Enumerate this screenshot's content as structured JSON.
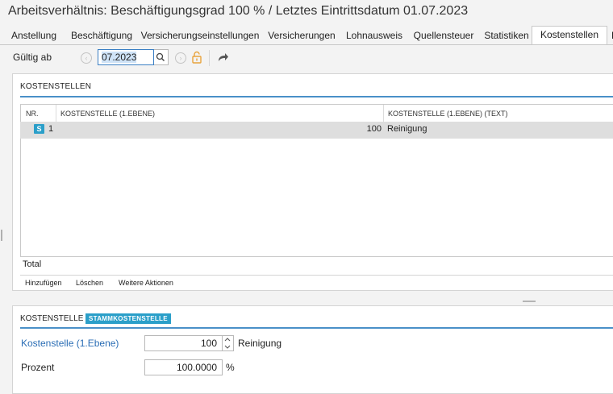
{
  "window": {
    "title": "Arbeitsverhältnis: Beschäftigungsgrad 100 % / Letztes Eintrittsdatum 01.07.2023"
  },
  "tabs": [
    {
      "label": "Anstellung"
    },
    {
      "label": "Beschäftigung"
    },
    {
      "label": "Versicherungseinstellungen"
    },
    {
      "label": "Versicherungen"
    },
    {
      "label": "Lohnausweis"
    },
    {
      "label": "Quellensteuer"
    },
    {
      "label": "Statistiken"
    },
    {
      "label": "Kostenstellen",
      "active": true
    },
    {
      "label": "D"
    }
  ],
  "toolbar": {
    "valid_from_label": "Gültig ab",
    "date_value": "07.2023",
    "icons": [
      "prev-circle-icon",
      "search-icon",
      "next-circle-icon",
      "unlock-icon",
      "share-arrow-icon"
    ]
  },
  "cost_centers_panel": {
    "title": "KOSTENSTELLEN",
    "columns": [
      "NR.",
      "KOSTENSTELLE (1.EBENE)",
      "KOSTENSTELLE (1.EBENE) (TEXT)"
    ],
    "rows": [
      {
        "badge": "S",
        "nr": "1",
        "kostenstelle": "100",
        "text": "Reinigung"
      }
    ],
    "total_label": "Total",
    "actions": [
      "Hinzufügen",
      "Löschen",
      "Weitere Aktionen"
    ]
  },
  "detail_panel": {
    "title": "KOSTENSTELLE",
    "badge": "STAMMKOSTENSTELLE",
    "fields": {
      "kostenstelle_label": "Kostenstelle (1.Ebene)",
      "kostenstelle_value": "100",
      "kostenstelle_text": "Reinigung",
      "prozent_label": "Prozent",
      "prozent_value": "100.0000",
      "prozent_unit": "%"
    }
  },
  "colors": {
    "accent": "#4a90c8",
    "badge": "#2b9fc9",
    "link_label": "#2a6db5",
    "lock": "#e8a33c"
  }
}
